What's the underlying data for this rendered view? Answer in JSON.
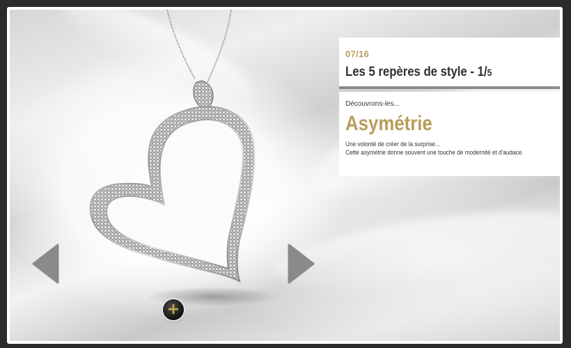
{
  "slide": {
    "date": "07/16",
    "title_main": "Les 5 repères de style - 1/",
    "title_small": "5",
    "subtitle": "Découvrons-les...",
    "heading": "Asymétrie",
    "description_lines": [
      "Une volonté de créer de la surprise...",
      "Cette asymétrie donne souvent une touche de modernité et d'audace."
    ]
  },
  "controls": {
    "prev_icon": "triangle-left-icon",
    "next_icon": "triangle-right-icon",
    "zoom_icon": "plus-icon",
    "zoom_label": "+"
  },
  "colors": {
    "gold": "#b79d5b",
    "arrow_gray": "#8a8a8a",
    "panel_divider": "#8c8c8c"
  }
}
